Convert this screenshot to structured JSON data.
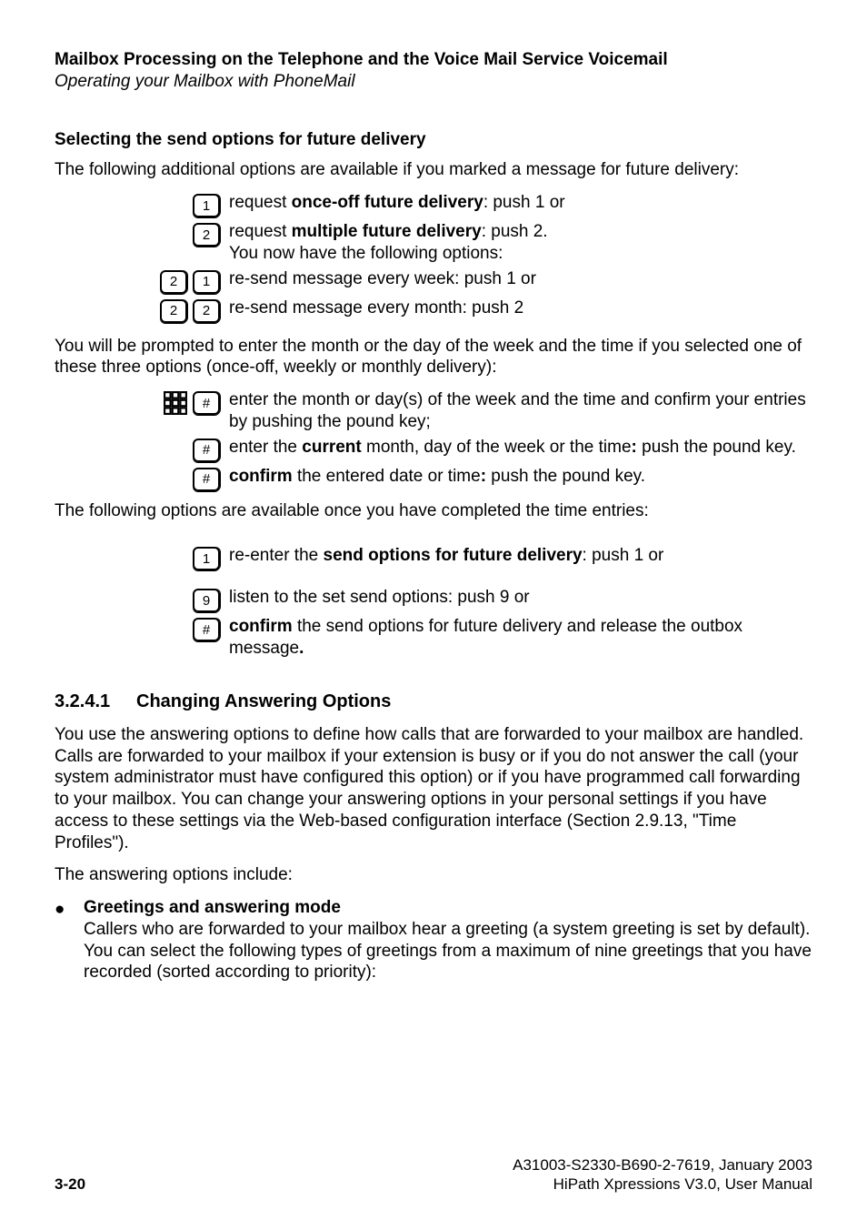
{
  "header": {
    "title": "Mailbox Processing on the Telephone and the Voice Mail Service Voicemail",
    "subtitle": "Operating your Mailbox with PhoneMail"
  },
  "section1": {
    "heading": "Selecting the send options for future delivery",
    "intro": "The following additional options are available if you marked a message for future delivery:",
    "r1_k1": "1",
    "r1_t_a": "request ",
    "r1_t_b": "once-off future delivery",
    "r1_t_c": ": push 1 or",
    "r2_k1": "2",
    "r2_t_a": "request ",
    "r2_t_b": "multiple future delivery",
    "r2_t_c": ": push 2.",
    "r2_t_d": "You now have the following options:",
    "r3_k1": "2",
    "r3_k2": "1",
    "r3_t": "re-send message every week: push 1 or",
    "r4_k1": "2",
    "r4_k2": "2",
    "r4_t": "re-send message every month: push 2",
    "prompt": "You will be prompted to enter the month or the day of the week and the time if you selected one of these three options (once-off, weekly or monthly delivery):",
    "r5_k1": "#",
    "r5_t": "enter the month or day(s) of the week and the time and confirm your entries by pushing the pound key;",
    "r6_k1": "#",
    "r6_t_a": "enter the ",
    "r6_t_b": "current",
    "r6_t_c": " month, day of the week or the time",
    "r6_t_d": ":",
    "r6_t_e": " push the pound key.",
    "r7_k1": "#",
    "r7_t_a": "confirm",
    "r7_t_b": " the entered date or time",
    "r7_t_c": ":",
    "r7_t_d": " push the pound key.",
    "afterTime": "The following options are available once you have completed the time entries:",
    "r8_k1": "1",
    "r8_t_a": "re-enter the ",
    "r8_t_b": "send options for future delivery",
    "r8_t_c": ": push 1 or",
    "r9_k1": "9",
    "r9_t": "listen to the set send options: push 9 or",
    "r10_k1": "#",
    "r10_t_a": "confirm",
    "r10_t_b": " the send options for future delivery and release the outbox message",
    "r10_t_c": "."
  },
  "section2": {
    "num": "3.2.4.1",
    "title": "Changing Answering Options",
    "para": "You use the answering options to define how calls that are forwarded to your mailbox are handled. Calls are forwarded to your mailbox if your extension is busy or if you do not answer the call (your system administrator must have configured this option) or if you have programmed call forwarding to your mailbox. You can change your answering options in your personal settings if you have access to these settings via the Web-based configuration interface (Section 2.9.13, \"Time Profiles\").",
    "include": "The answering options include:",
    "bullet_title": "Greetings and answering mode",
    "bullet_body": "Callers who are forwarded to your mailbox hear a greeting (a system greeting is set by default). You can select the following types of greetings from a maximum of nine greetings that you have recorded (sorted according to priority):"
  },
  "footer": {
    "pagenum": "3-20",
    "docid": "A31003-S2330-B690-2-7619, January 2003",
    "product": "HiPath Xpressions V3.0, User Manual"
  }
}
